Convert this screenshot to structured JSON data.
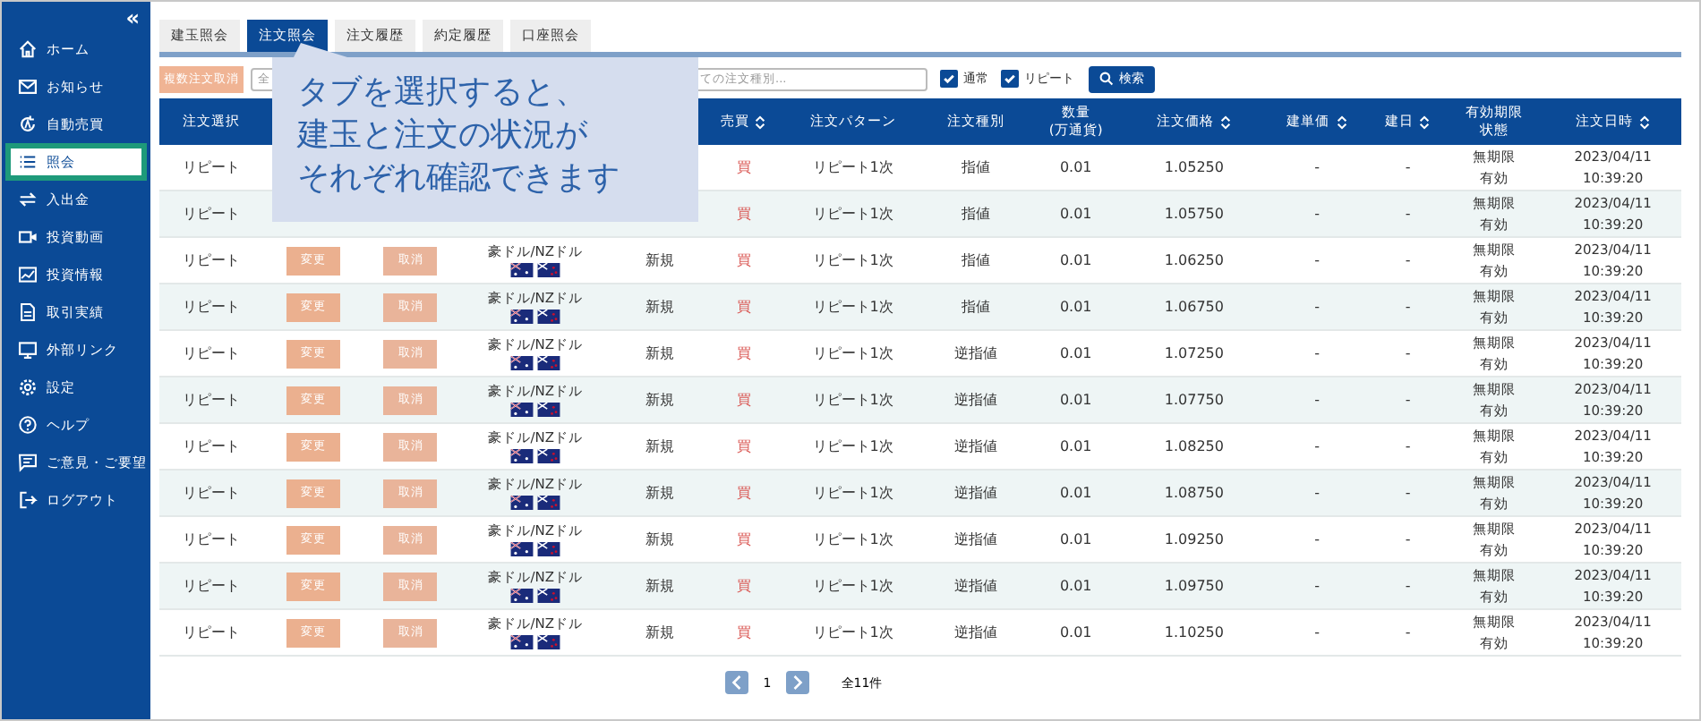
{
  "sidebar": {
    "collapse": "«",
    "items": [
      {
        "label": "ホーム",
        "selected": false
      },
      {
        "label": "お知らせ",
        "selected": false
      },
      {
        "label": "自動売買",
        "selected": false
      },
      {
        "label": "照会",
        "selected": true
      },
      {
        "label": "入出金",
        "selected": false
      },
      {
        "label": "投資動画",
        "selected": false
      },
      {
        "label": "投資情報",
        "selected": false
      },
      {
        "label": "取引実績",
        "selected": false
      },
      {
        "label": "外部リンク",
        "selected": false
      },
      {
        "label": "設定",
        "selected": false
      },
      {
        "label": "ヘルプ",
        "selected": false
      },
      {
        "label": "ご意見・ご要望",
        "selected": false
      },
      {
        "label": "ログアウト",
        "selected": false
      }
    ]
  },
  "tabs": [
    {
      "label": "建玉照会",
      "selected": false
    },
    {
      "label": "注文照会",
      "selected": true
    },
    {
      "label": "注文履歴",
      "selected": false
    },
    {
      "label": "約定履歴",
      "selected": false
    },
    {
      "label": "口座照会",
      "selected": false
    }
  ],
  "toolbar": {
    "bulk_cancel": "複数注文取消",
    "first_field_visible": "全",
    "type_field_visible": "ての注文種別...",
    "filters": [
      {
        "label": "通常",
        "checked": true
      },
      {
        "label": "リピート",
        "checked": true
      }
    ],
    "search": "検索"
  },
  "callout": {
    "lines": [
      "タブを選択すると、",
      "建玉と注文の状況が",
      "それぞれ確認できます"
    ]
  },
  "table": {
    "columns": [
      {
        "lines": [
          "注文選択"
        ],
        "sort": false
      },
      {
        "lines": [
          "売買"
        ],
        "sort": true
      },
      {
        "lines": [
          "注文パターン"
        ],
        "sort": false
      },
      {
        "lines": [
          "注文種別"
        ],
        "sort": false
      },
      {
        "lines": [
          "数量",
          "(万通貨)"
        ],
        "sort": false
      },
      {
        "lines": [
          "注文価格"
        ],
        "sort": true
      },
      {
        "lines": [
          "建単価"
        ],
        "sort": true
      },
      {
        "lines": [
          "建日"
        ],
        "sort": true
      },
      {
        "lines": [
          "有効期限",
          "状態"
        ],
        "sort": false
      },
      {
        "lines": [
          "注文日時"
        ],
        "sort": true
      }
    ],
    "rows": [
      {
        "select": "リピート",
        "side": "買",
        "pattern": "リピート1次",
        "type": "指値",
        "qty": "0.01",
        "price": "1.05250",
        "entry": "-",
        "entry_date": "-",
        "expiry": "無期限",
        "status": "有効",
        "date": "2023/04/11",
        "time": "10:39:20"
      },
      {
        "select": "リピート",
        "side": "買",
        "pattern": "リピート1次",
        "type": "指値",
        "qty": "0.01",
        "price": "1.05750",
        "entry": "-",
        "entry_date": "-",
        "expiry": "無期限",
        "status": "有効",
        "date": "2023/04/11",
        "time": "10:39:20"
      },
      {
        "select": "リピート",
        "change": "変更",
        "cancel": "取消",
        "pair": "豪ドル/NZドル",
        "kind": "新規",
        "side": "買",
        "pattern": "リピート1次",
        "type": "指値",
        "qty": "0.01",
        "price": "1.06250",
        "entry": "-",
        "entry_date": "-",
        "expiry": "無期限",
        "status": "有効",
        "date": "2023/04/11",
        "time": "10:39:20"
      },
      {
        "select": "リピート",
        "change": "変更",
        "cancel": "取消",
        "pair": "豪ドル/NZドル",
        "kind": "新規",
        "side": "買",
        "pattern": "リピート1次",
        "type": "指値",
        "qty": "0.01",
        "price": "1.06750",
        "entry": "-",
        "entry_date": "-",
        "expiry": "無期限",
        "status": "有効",
        "date": "2023/04/11",
        "time": "10:39:20"
      },
      {
        "select": "リピート",
        "change": "変更",
        "cancel": "取消",
        "pair": "豪ドル/NZドル",
        "kind": "新規",
        "side": "買",
        "pattern": "リピート1次",
        "type": "逆指値",
        "qty": "0.01",
        "price": "1.07250",
        "entry": "-",
        "entry_date": "-",
        "expiry": "無期限",
        "status": "有効",
        "date": "2023/04/11",
        "time": "10:39:20"
      },
      {
        "select": "リピート",
        "change": "変更",
        "cancel": "取消",
        "pair": "豪ドル/NZドル",
        "kind": "新規",
        "side": "買",
        "pattern": "リピート1次",
        "type": "逆指値",
        "qty": "0.01",
        "price": "1.07750",
        "entry": "-",
        "entry_date": "-",
        "expiry": "無期限",
        "status": "有効",
        "date": "2023/04/11",
        "time": "10:39:20"
      },
      {
        "select": "リピート",
        "change": "変更",
        "cancel": "取消",
        "pair": "豪ドル/NZドル",
        "kind": "新規",
        "side": "買",
        "pattern": "リピート1次",
        "type": "逆指値",
        "qty": "0.01",
        "price": "1.08250",
        "entry": "-",
        "entry_date": "-",
        "expiry": "無期限",
        "status": "有効",
        "date": "2023/04/11",
        "time": "10:39:20"
      },
      {
        "select": "リピート",
        "change": "変更",
        "cancel": "取消",
        "pair": "豪ドル/NZドル",
        "kind": "新規",
        "side": "買",
        "pattern": "リピート1次",
        "type": "逆指値",
        "qty": "0.01",
        "price": "1.08750",
        "entry": "-",
        "entry_date": "-",
        "expiry": "無期限",
        "status": "有効",
        "date": "2023/04/11",
        "time": "10:39:20"
      },
      {
        "select": "リピート",
        "change": "変更",
        "cancel": "取消",
        "pair": "豪ドル/NZドル",
        "kind": "新規",
        "side": "買",
        "pattern": "リピート1次",
        "type": "逆指値",
        "qty": "0.01",
        "price": "1.09250",
        "entry": "-",
        "entry_date": "-",
        "expiry": "無期限",
        "status": "有効",
        "date": "2023/04/11",
        "time": "10:39:20"
      },
      {
        "select": "リピート",
        "change": "変更",
        "cancel": "取消",
        "pair": "豪ドル/NZドル",
        "kind": "新規",
        "side": "買",
        "pattern": "リピート1次",
        "type": "逆指値",
        "qty": "0.01",
        "price": "1.09750",
        "entry": "-",
        "entry_date": "-",
        "expiry": "無期限",
        "status": "有効",
        "date": "2023/04/11",
        "time": "10:39:20"
      },
      {
        "select": "リピート",
        "change": "変更",
        "cancel": "取消",
        "pair": "豪ドル/NZドル",
        "kind": "新規",
        "side": "買",
        "pattern": "リピート1次",
        "type": "逆指値",
        "qty": "0.01",
        "price": "1.10250",
        "entry": "-",
        "entry_date": "-",
        "expiry": "無期限",
        "status": "有効",
        "date": "2023/04/11",
        "time": "10:39:20"
      }
    ]
  },
  "pagination": {
    "page": "1",
    "total": "全11件"
  }
}
